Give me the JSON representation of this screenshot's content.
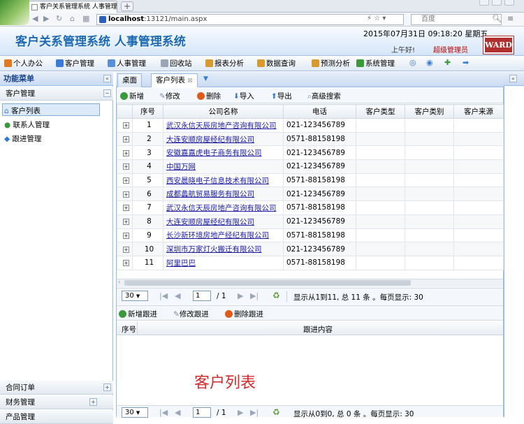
{
  "browser": {
    "tab_title": "客户关系管理系统 人事管理 ×",
    "url_host": "localhost",
    "url_rest": ":13121/main.aspx",
    "search_placeholder": "百度"
  },
  "header": {
    "app_title": "客户关系管理系统 人事管理系统",
    "datetime": "2015年07月31日 09:18:20 星期五",
    "greeting": "上午好!",
    "role": "超级管理员",
    "logo_text": "WARD"
  },
  "menubar": [
    {
      "label": "个人办公",
      "icon_color": "#e07a1f"
    },
    {
      "label": "客户管理",
      "icon_color": "#3a7bd5"
    },
    {
      "label": "人事管理",
      "icon_color": "#5a8ed6"
    },
    {
      "label": "回收站",
      "icon_color": "#9aa6b6"
    },
    {
      "label": "报表分析",
      "icon_color": "#d89a2a"
    },
    {
      "label": "数据查询",
      "icon_color": "#d89a2a"
    },
    {
      "label": "预测分析",
      "icon_color": "#d89a2a"
    },
    {
      "label": "系统管理",
      "icon_color": "#3a9a3a"
    }
  ],
  "sidebar": {
    "title": "功能菜单",
    "section": "客户管理",
    "items": [
      {
        "label": "客户列表",
        "icon": "home-icon"
      },
      {
        "label": "联系人管理",
        "icon": "person-icon"
      },
      {
        "label": "跟进管理",
        "icon": "follow-icon"
      }
    ],
    "bottom_sections": [
      "合同订单",
      "财务管理",
      "产品管理"
    ]
  },
  "tabs": [
    "桌面",
    "客户列表"
  ],
  "toolbar": [
    "新增",
    "修改",
    "删除",
    "导入",
    "导出",
    "高级搜索"
  ],
  "grid": {
    "columns": [
      "",
      "序号",
      "公司名称",
      "电话",
      "客户类型",
      "客户类别",
      "客户来源"
    ],
    "rows": [
      {
        "no": "1",
        "company": "武汉永信天辰房地产咨询有限公司",
        "phone": "021-123456789"
      },
      {
        "no": "2",
        "company": "大连安顺房屋经纪有限公司",
        "phone": "0571-88158198"
      },
      {
        "no": "3",
        "company": "安徽嘉嘉虎电子商务有限公司",
        "phone": "021-123456789"
      },
      {
        "no": "4",
        "company": "中国万网",
        "phone": "021-123456789"
      },
      {
        "no": "5",
        "company": "西安晨晓电子信息技术有限公司",
        "phone": "0571-88158198"
      },
      {
        "no": "6",
        "company": "成都蠡航贸易服务有限公司",
        "phone": "021-123456789"
      },
      {
        "no": "7",
        "company": "武汉永信天辰房地产咨询有限公司",
        "phone": "0571-88158198"
      },
      {
        "no": "8",
        "company": "大连安顺房屋经纪有限公司",
        "phone": "021-123456789"
      },
      {
        "no": "9",
        "company": "长沙新环境房地产经纪有限公司",
        "phone": "0571-88158198"
      },
      {
        "no": "10",
        "company": "深圳市万家灯火搬迁有限公司",
        "phone": "021-123456789"
      },
      {
        "no": "11",
        "company": "阿里巴巴",
        "phone": "0571-88158198"
      }
    ]
  },
  "pager": {
    "page_size": "30",
    "current_page": "1",
    "total_pages": "/ 1",
    "info": "显示从1到11, 总 11 条 。每页显示: 30"
  },
  "follow": {
    "toolbar": [
      "新增跟进",
      "修改跟进",
      "删除跟进"
    ],
    "columns": [
      "序号",
      "跟进内容"
    ],
    "pager": {
      "page_size": "30",
      "current_page": "1",
      "total_pages": "/ 1",
      "info": "显示从0到0, 总 0 条 。每页显示: 30"
    }
  },
  "watermark": "客户列表"
}
